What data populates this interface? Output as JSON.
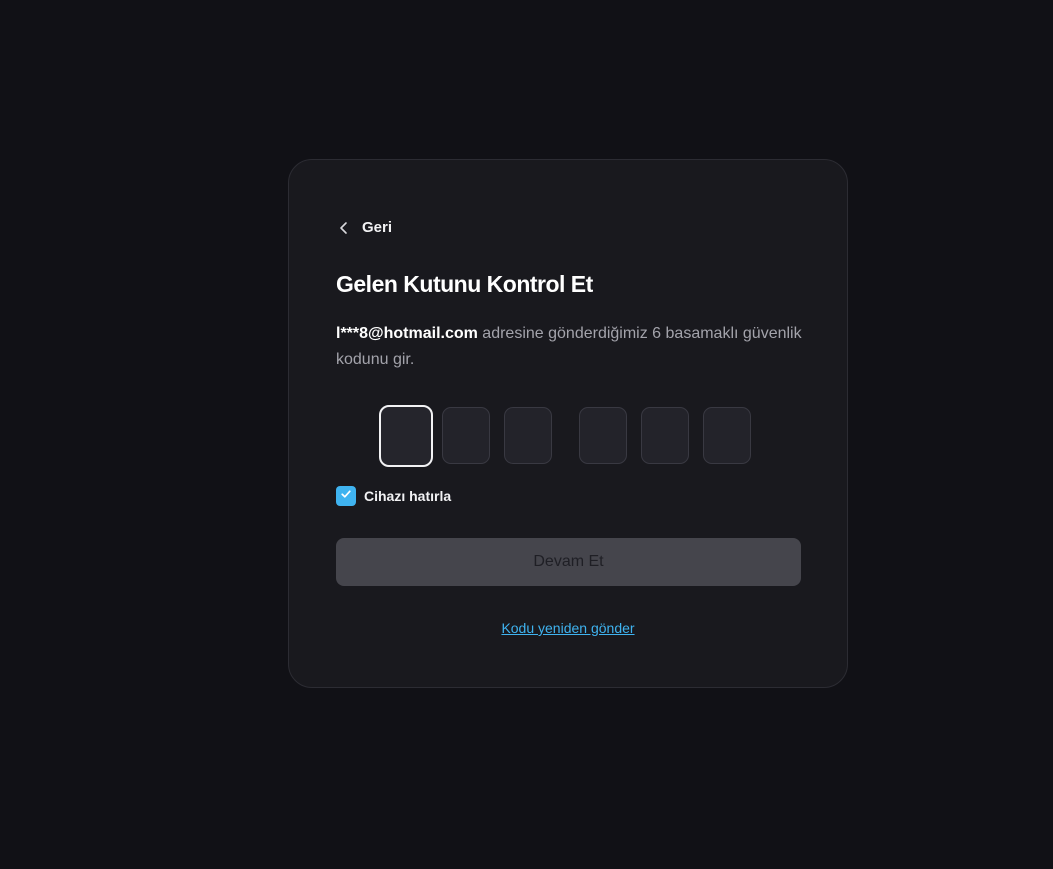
{
  "back": {
    "label": "Geri",
    "icon": "chevron-left-icon"
  },
  "title": "Gelen Kutunu Kontrol Et",
  "description": {
    "email": "l***8@hotmail.com",
    "text": " adresine gönderdiğimiz 6 basamaklı güvenlik kodunu gir."
  },
  "otp": {
    "digits": [
      "",
      "",
      "",
      "",
      "",
      ""
    ],
    "active_index": 0
  },
  "remember": {
    "label": "Cihazı hatırla",
    "checked": true,
    "icon": "checkmark-icon"
  },
  "submit": {
    "label": "Devam Et",
    "disabled": true
  },
  "resend": {
    "label": "Kodu yeniden gönder"
  },
  "colors": {
    "page_background": "#111116",
    "card_background": "#19191e",
    "accent": "#3fb3f0",
    "button_disabled": "#45454c"
  }
}
